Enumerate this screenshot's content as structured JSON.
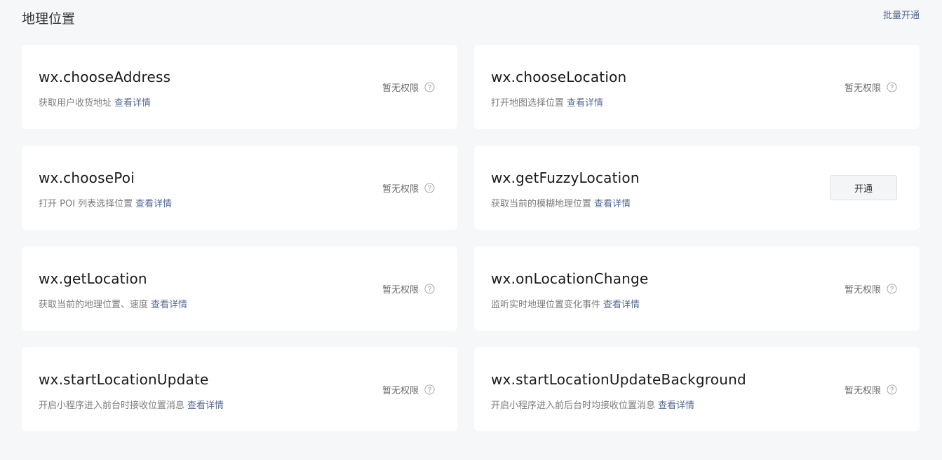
{
  "section": {
    "title": "地理位置",
    "batch_label": "批量开通"
  },
  "detail_label": "查看详情",
  "no_permission_label": "暂无权限",
  "open_label": "开通",
  "cards": [
    {
      "name": "wx.chooseAddress",
      "desc": "获取用户收货地址",
      "action": "none"
    },
    {
      "name": "wx.chooseLocation",
      "desc": "打开地图选择位置",
      "action": "none"
    },
    {
      "name": "wx.choosePoi",
      "desc": "打开 POI 列表选择位置",
      "action": "none"
    },
    {
      "name": "wx.getFuzzyLocation",
      "desc": "获取当前的模糊地理位置",
      "action": "open"
    },
    {
      "name": "wx.getLocation",
      "desc": "获取当前的地理位置、速度",
      "action": "none"
    },
    {
      "name": "wx.onLocationChange",
      "desc": "监听实时地理位置变化事件",
      "action": "none"
    },
    {
      "name": "wx.startLocationUpdate",
      "desc": "开启小程序进入前台时接收位置消息",
      "action": "none"
    },
    {
      "name": "wx.startLocationUpdateBackground",
      "desc": "开启小程序进入前后台时均接收位置消息",
      "action": "none"
    }
  ],
  "icons": {
    "help": "question-circle-icon"
  },
  "colors": {
    "link": "#576b95",
    "background": "#f6f7f9",
    "card": "#ffffff"
  }
}
